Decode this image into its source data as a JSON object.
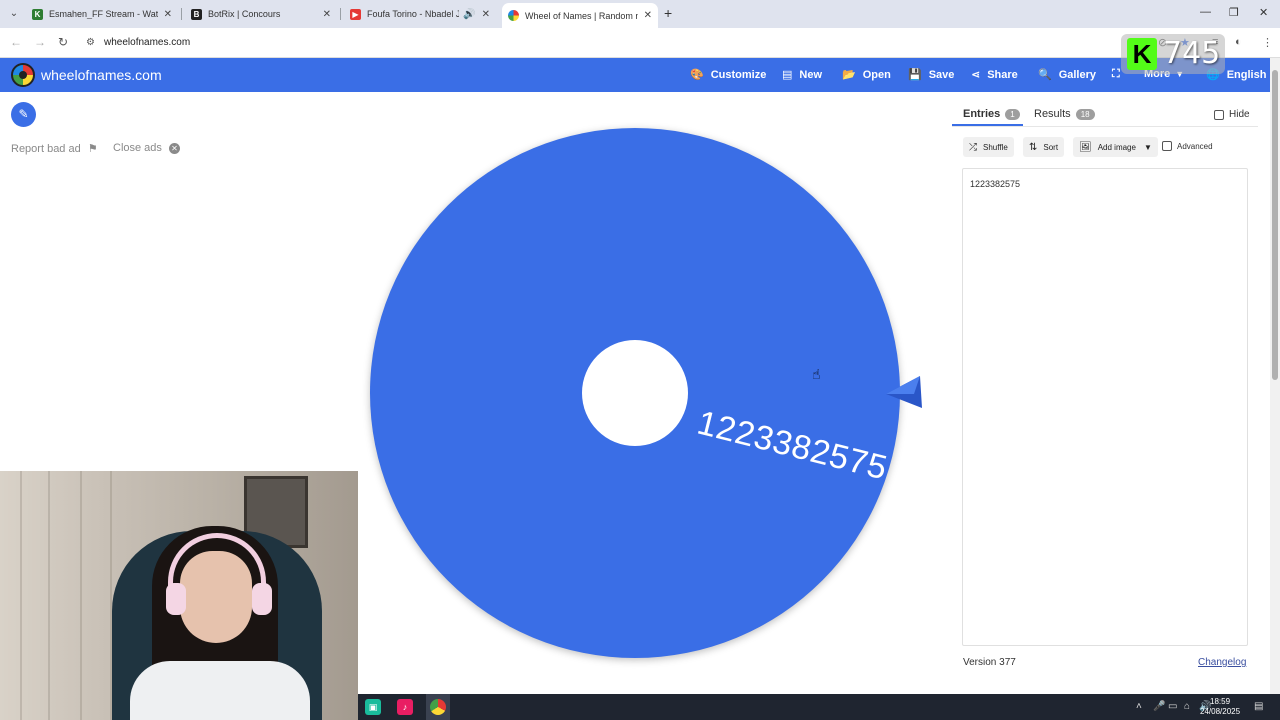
{
  "browser": {
    "tabs": [
      {
        "title": "Esmahen_FF Stream - Watch Li",
        "favicon_color": "#2e7d32",
        "favicon_glyph": "K"
      },
      {
        "title": "BotRix | Concours",
        "favicon_color": "#222222",
        "favicon_glyph": "B"
      },
      {
        "title": "Foufa Torino - Nbadel Jorra",
        "favicon_color": "#e53935",
        "favicon_glyph": "▶"
      },
      {
        "title": "Wheel of Names | Random nan",
        "favicon_color": "#1e88e5",
        "favicon_glyph": "●"
      }
    ],
    "url": "wheelofnames.com"
  },
  "app": {
    "site_name": "wheelofnames.com",
    "menu": {
      "customize": "Customize",
      "new": "New",
      "open": "Open",
      "save": "Save",
      "share": "Share",
      "gallery": "Gallery",
      "more": "More",
      "language": "English"
    },
    "accent_color": "#3a6ee6"
  },
  "ads": {
    "report": "Report bad ad",
    "close": "Close ads"
  },
  "wheel": {
    "segment_label": "1223382575",
    "segment_color": "#3a6ee6"
  },
  "panel": {
    "tabs": {
      "entries": "Entries",
      "entries_count": "1",
      "results": "Results",
      "results_count": "18"
    },
    "hide_label": "Hide",
    "tools": {
      "shuffle": "Shuffle",
      "sort": "Sort",
      "add_image": "Add image",
      "advanced": "Advanced"
    },
    "entries_text": "1223382575",
    "version": "Version 377",
    "changelog": "Changelog"
  },
  "overlay": {
    "kick_count": "745"
  },
  "taskbar": {
    "time": "18:59",
    "date": "24/08/2025"
  }
}
